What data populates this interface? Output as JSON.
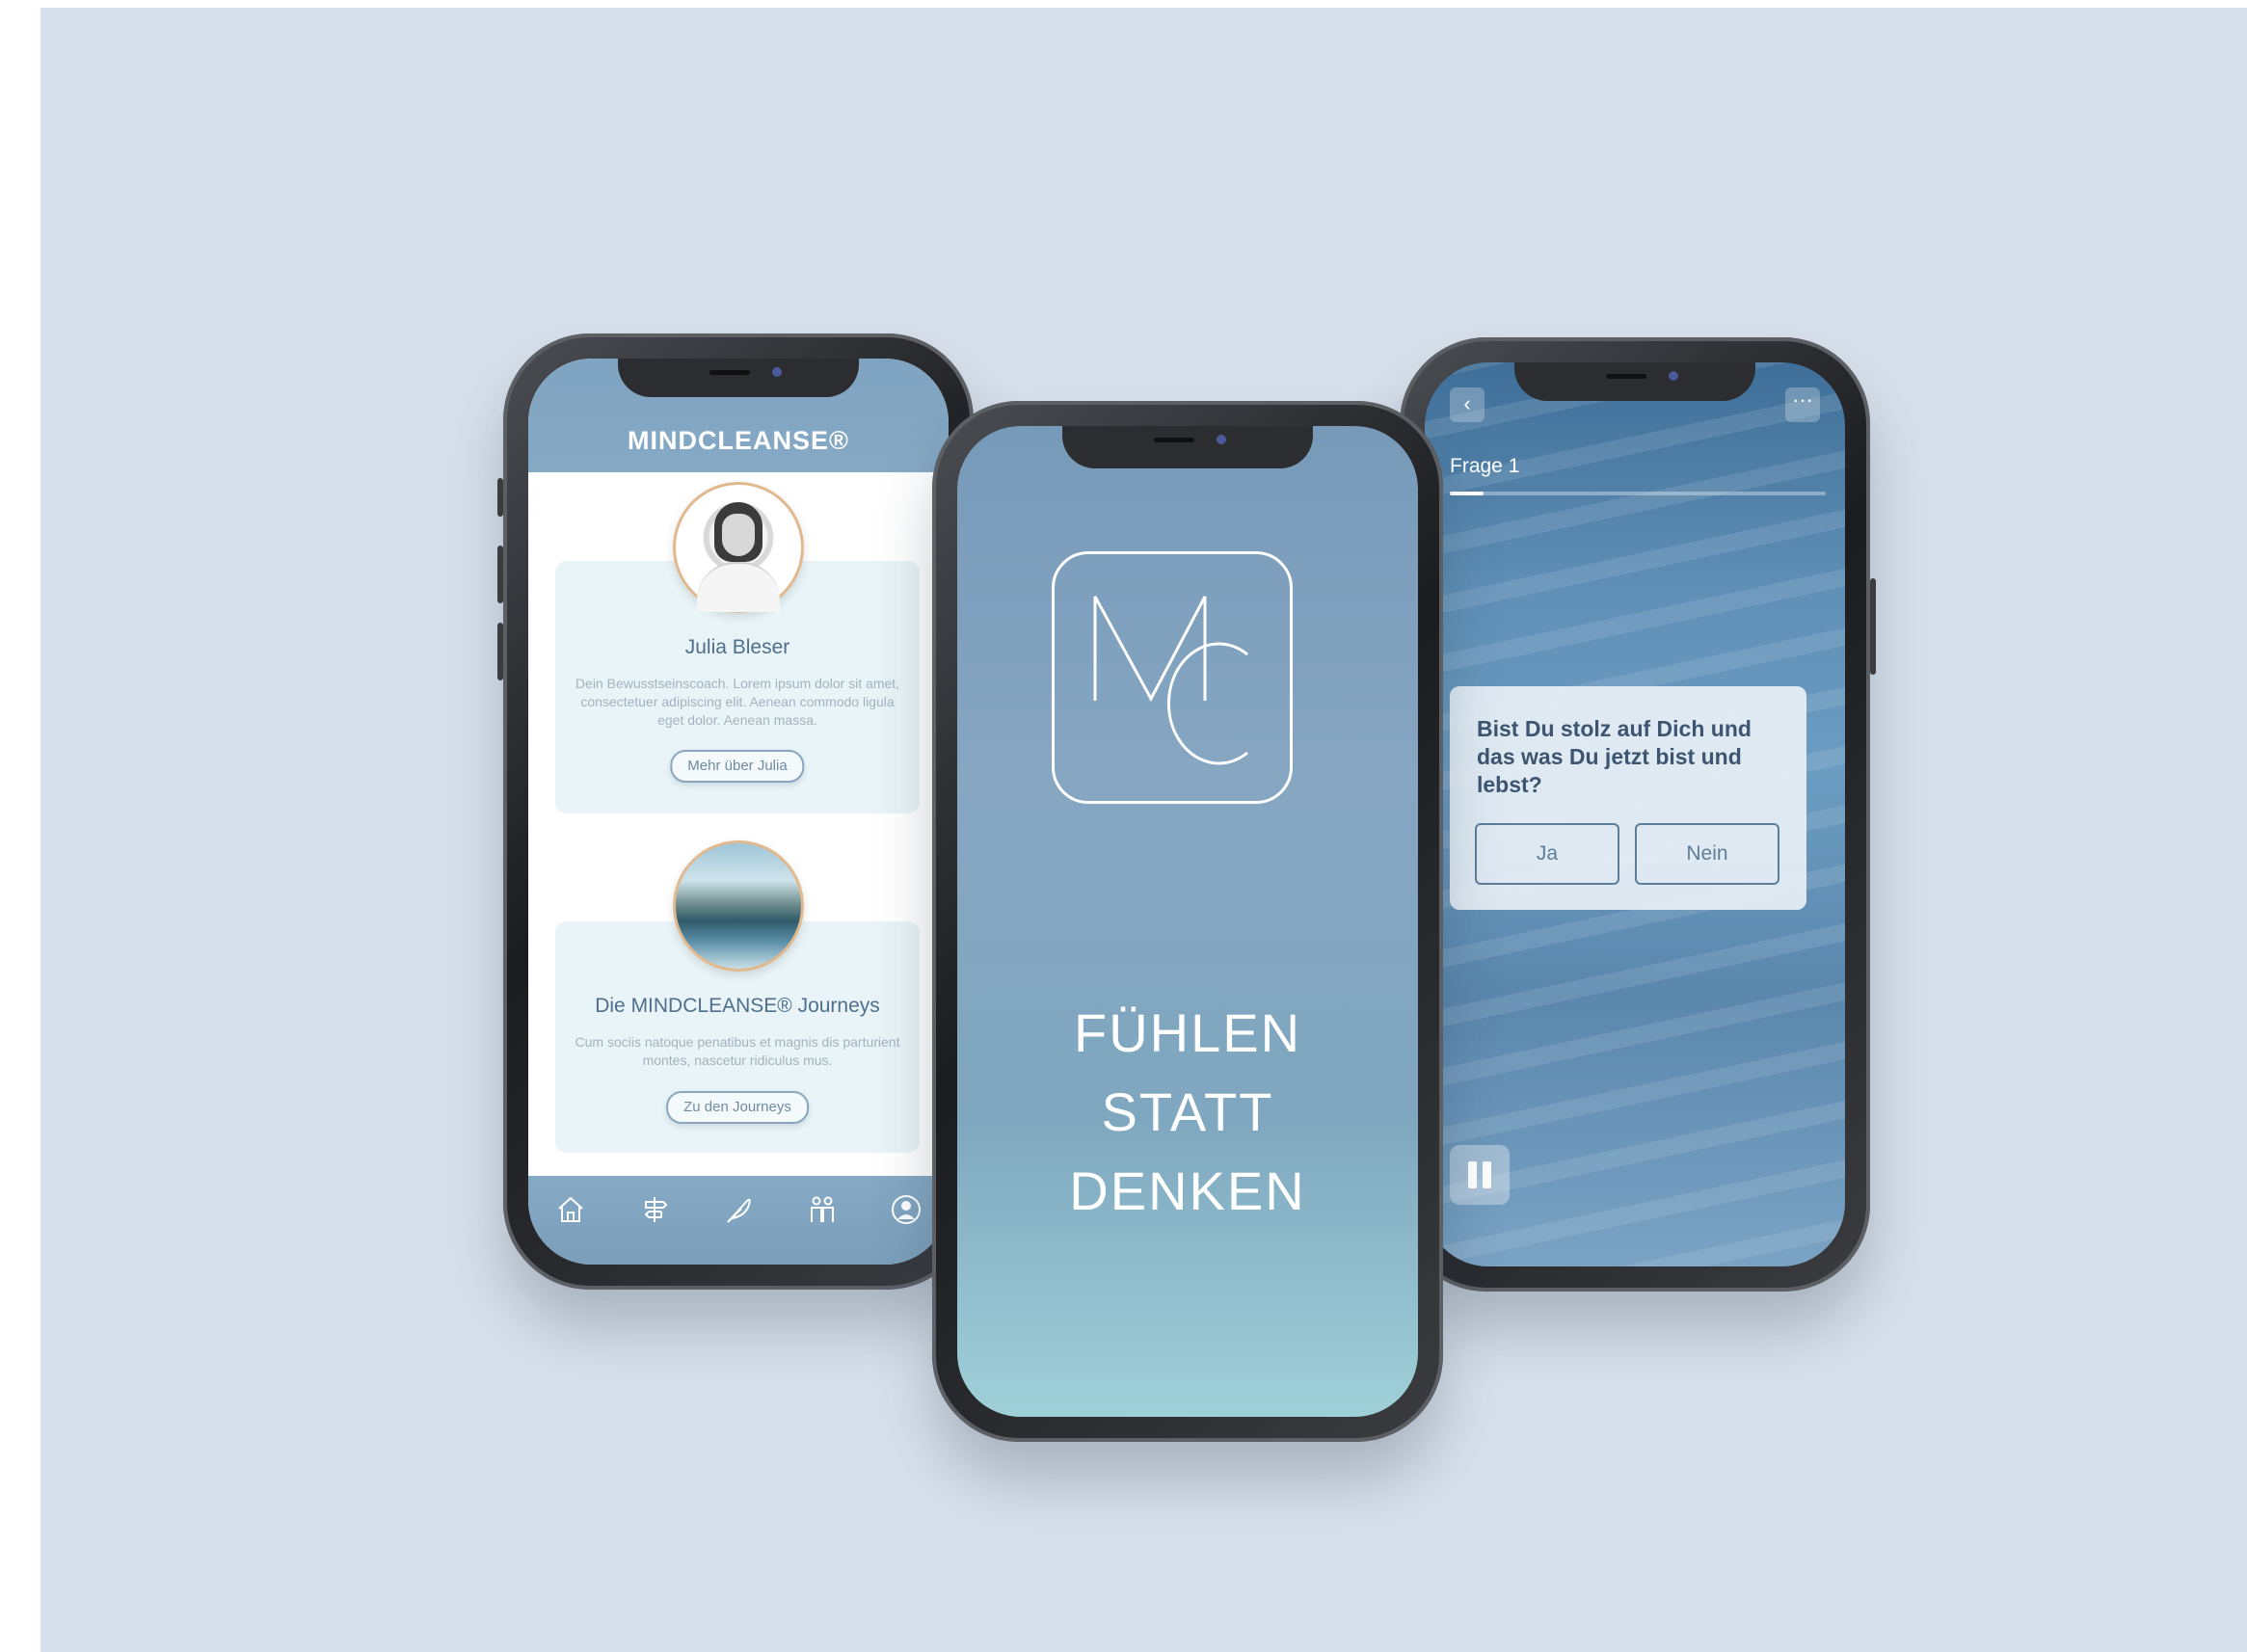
{
  "colors": {
    "background": "#d7e0ea",
    "brand_blue": "#7fa4c1",
    "card_bg": "#e8f4f7",
    "avatar_ring": "#e0b98f",
    "text_dark": "#4f6f8c"
  },
  "left_phone": {
    "brand": "MINDCLEANSE®",
    "coach_card": {
      "name": "Julia Bleser",
      "text": "Dein Bewusstseinscoach. Lorem ipsum dolor sit amet, consectetuer adipiscing elit. Aenean commodo ligula eget dolor. Aenean massa.",
      "button": "Mehr über Julia"
    },
    "journeys_card": {
      "title": "Die MINDCLEANSE® Journeys",
      "text": "Cum sociis natoque penatibus et magnis dis parturient montes, nascetur ridiculus mus.",
      "button": "Zu den Journeys"
    },
    "tabbar_icons": [
      "home-icon",
      "signpost-icon",
      "feather-icon",
      "people-icon",
      "profile-icon"
    ]
  },
  "center_phone": {
    "logo_letters": "MC",
    "claim_line1": "FÜHLEN",
    "claim_line2": "STATT",
    "claim_line3": "DENKEN"
  },
  "right_phone": {
    "question_label": "Frage 1",
    "progress_fraction": 0.09,
    "question": "Bist Du stolz auf Dich und das was Du jetzt bist und lebst?",
    "yes_label": "Ja",
    "no_label": "Nein",
    "icons": [
      "back-icon",
      "more-icon",
      "pause-icon"
    ]
  }
}
